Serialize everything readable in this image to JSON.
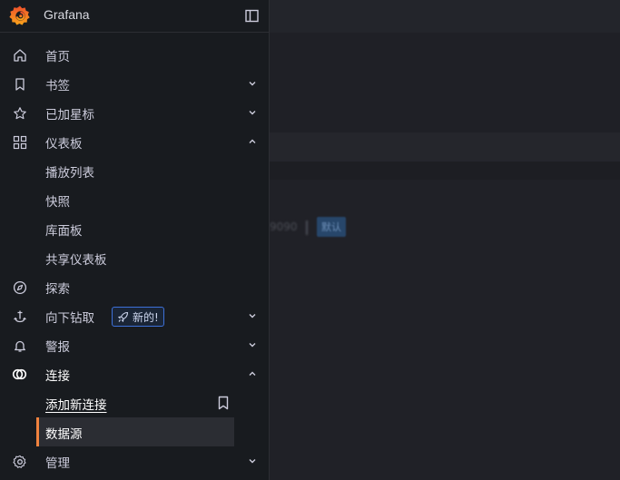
{
  "app": {
    "title": "Grafana"
  },
  "menu": {
    "items": [
      {
        "label": "首页",
        "icon": "home-icon"
      },
      {
        "label": "书签",
        "icon": "bookmark-icon",
        "expanded": false
      },
      {
        "label": "已加星标",
        "icon": "star-icon",
        "expanded": false
      },
      {
        "label": "仪表板",
        "icon": "apps-icon",
        "expanded": true,
        "children": [
          "播放列表",
          "快照",
          "库面板",
          "共享仪表板"
        ]
      },
      {
        "label": "探索",
        "icon": "compass-icon"
      },
      {
        "label": "向下钻取",
        "icon": "drilldown-icon",
        "expanded": false,
        "badge": "新的!"
      },
      {
        "label": "警报",
        "icon": "bell-icon",
        "expanded": false
      },
      {
        "label": "连接",
        "icon": "link-icon",
        "expanded": true,
        "children": [
          "添加新连接",
          "数据源"
        ]
      },
      {
        "label": "管理",
        "icon": "cog-icon",
        "expanded": false
      }
    ],
    "active_child": "数据源"
  },
  "background": {
    "url_fragment": "9090",
    "default_badge": "默认"
  },
  "colors": {
    "sidebar_bg": "#181b1f",
    "active_indicator": "#f0823e",
    "badge_border": "#3d71d9",
    "default_badge_bg": "#27466a"
  }
}
